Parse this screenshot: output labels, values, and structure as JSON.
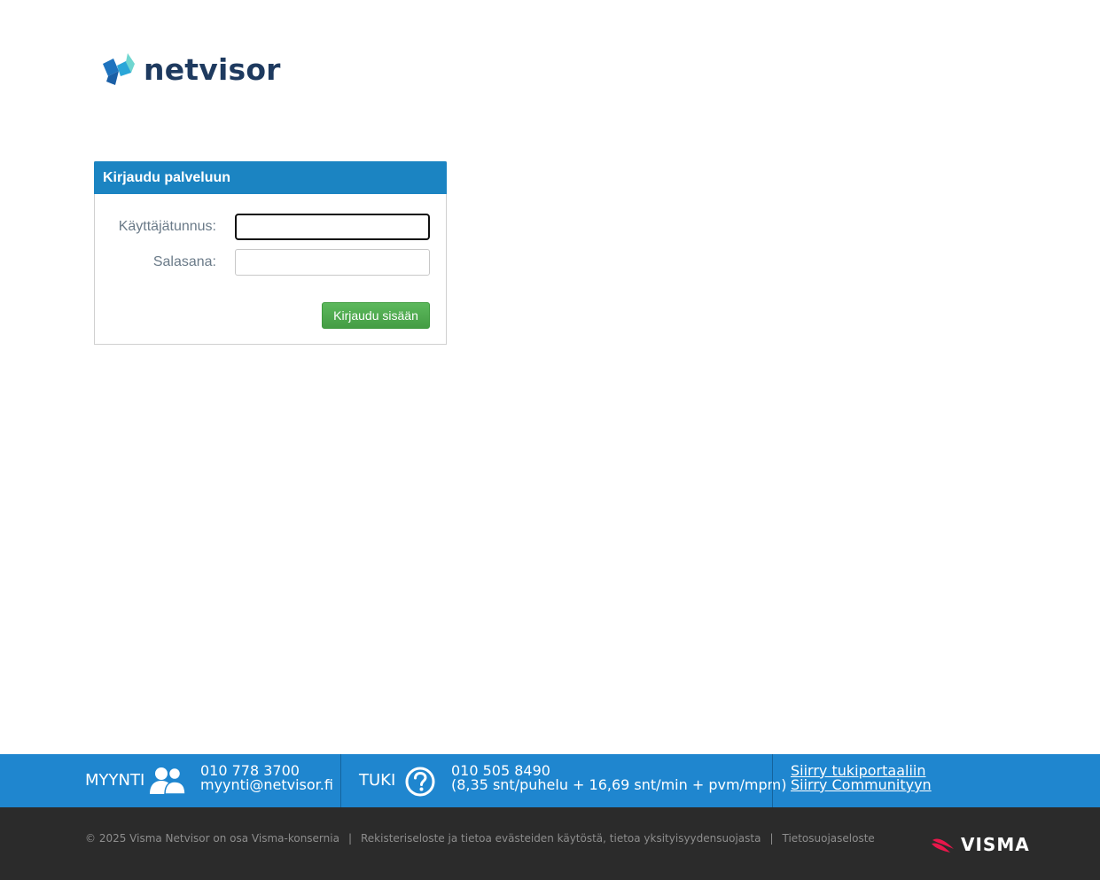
{
  "brand": {
    "logo_text": "netvisor",
    "logo_icon": "netvisor-logo-mark"
  },
  "login": {
    "title": "Kirjaudu palveluun",
    "username_label": "Käyttäjätunnus:",
    "username_value": "",
    "password_label": "Salasana:",
    "password_value": "",
    "submit_label": "Kirjaudu sisään"
  },
  "contact": {
    "sales_label": "MYYNTI",
    "sales_icon": "people-icon",
    "sales_phone": "010 778 3700",
    "sales_email": "myynti@netvisor.fi",
    "support_label": "TUKI",
    "support_icon": "help-icon",
    "support_phone": "010 505 8490",
    "support_price": "(8,35 snt/puhelu + 16,69 snt/min + pvm/mpm)",
    "link_support_portal": "Siirry tukiportaaliin",
    "link_community": "Siirry Communityyn"
  },
  "footer": {
    "copyright": "© 2025 Visma Netvisor on osa Visma-konsernia",
    "separator": "|",
    "link_privacy_cookies": "Rekisteriseloste ja tietoa evästeiden käytöstä, tietoa yksityisyydensuojasta",
    "link_privacy_statement": "Tietosuojaseloste",
    "visma_text": "VISMA"
  },
  "colors": {
    "header_blue": "#1b84c2",
    "contact_bar": "#1f86cf",
    "bottom_bar": "#2b2b2b",
    "button_green": "#5cb85c",
    "brand_navy": "#1e3a5f",
    "visma_red": "#e8174b"
  }
}
